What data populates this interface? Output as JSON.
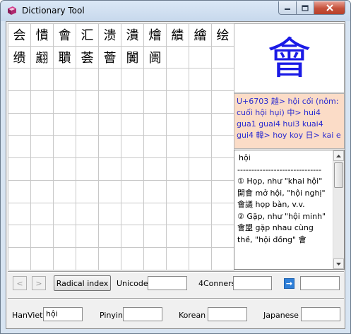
{
  "window": {
    "title": "Dictionary Tool",
    "controls": {
      "minimize": "minimize",
      "maximize": "maximize",
      "close": "close"
    }
  },
  "grid": {
    "characters": [
      "会",
      "憒",
      "會",
      "汇",
      "溃",
      "潰",
      "燴",
      "繢",
      "繪",
      "绘",
      "缋",
      "翽",
      "聵",
      "荟",
      "薈",
      "闠",
      "阓"
    ],
    "empty_cells": 93
  },
  "detail": {
    "big_char": "會",
    "readings": "U+6703 越> hội cối (nôm: cuối hội hụi) 中> hui4 gua1 guai4 hui3 kuai4 gui4 韓> hoy koy 日> kai e",
    "definition_lines": [
      "hội",
      "------------------------------",
      "① Họp, như \"khai hội\" 開會 mở hội, \"hội nghị\" 會議 họp bàn, v.v.",
      "② Gặp, như \"hội minh\" 會盟 gặp nhau cùng thề, \"hội đồng\" 會"
    ]
  },
  "toolbar": {
    "prev": "<",
    "next": ">",
    "radical_index": "Radical index",
    "unicode_label": "Unicode",
    "unicode_value": "",
    "fourcorners_label": "4Conners",
    "fourcorners_value": "",
    "go_icon": "→",
    "extra_value": ""
  },
  "readings_row": {
    "hanviet_label": "HanViet",
    "hanviet_value": "hội",
    "pinyin_label": "Pinyin",
    "pinyin_value": "",
    "korean_label": "Korean",
    "korean_value": "",
    "japanese_label": "Japanese",
    "japanese_value": ""
  },
  "colors": {
    "big_char": "#1a1ae6",
    "readings_bg": "#fbdcc7",
    "readings_text": "#2a2ad0",
    "go_button": "#2f7fd8",
    "close_button": "#c5513b"
  }
}
